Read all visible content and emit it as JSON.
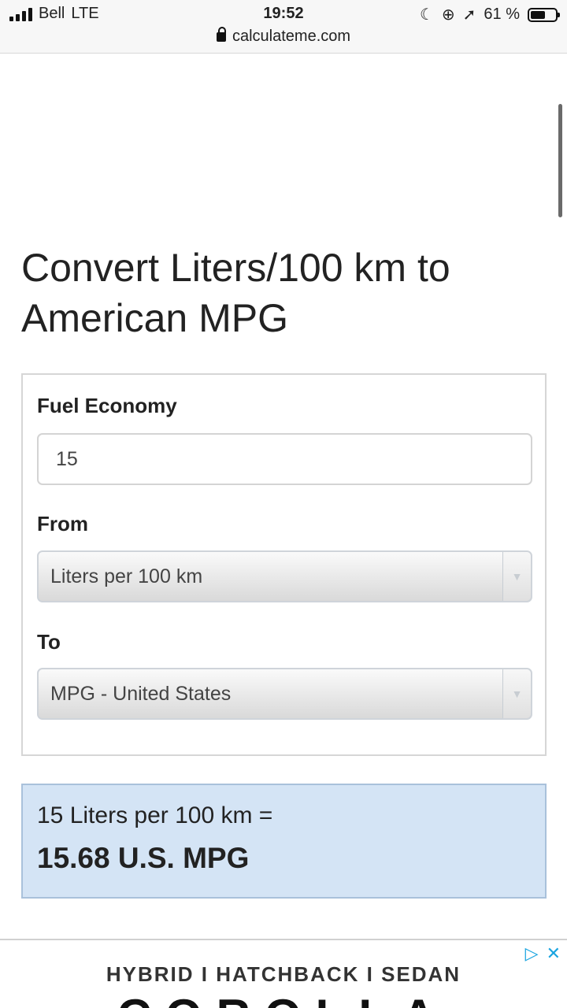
{
  "status_bar": {
    "carrier": "Bell",
    "network": "LTE",
    "time": "19:52",
    "battery_percent": "61 %",
    "battery_level": 0.61,
    "url": "calculateme.com"
  },
  "page": {
    "title": "Convert Liters/100 km to American MPG"
  },
  "form": {
    "fuel_label": "Fuel Economy",
    "fuel_value": "15",
    "from_label": "From",
    "from_selected": "Liters per 100 km",
    "to_label": "To",
    "to_selected": "MPG - United States"
  },
  "result": {
    "equation": "15 Liters per 100 km =",
    "value": "15.68 U.S. MPG"
  },
  "ad": {
    "tagline": "HYBRID I HATCHBACK I SEDAN",
    "brand": "COROLLA",
    "adchoices_icon": "▷",
    "close_icon": "✕"
  },
  "colors": {
    "result_bg": "#d4e4f5",
    "result_border": "#a9c1db",
    "ad_icon": "#19a4e0"
  }
}
